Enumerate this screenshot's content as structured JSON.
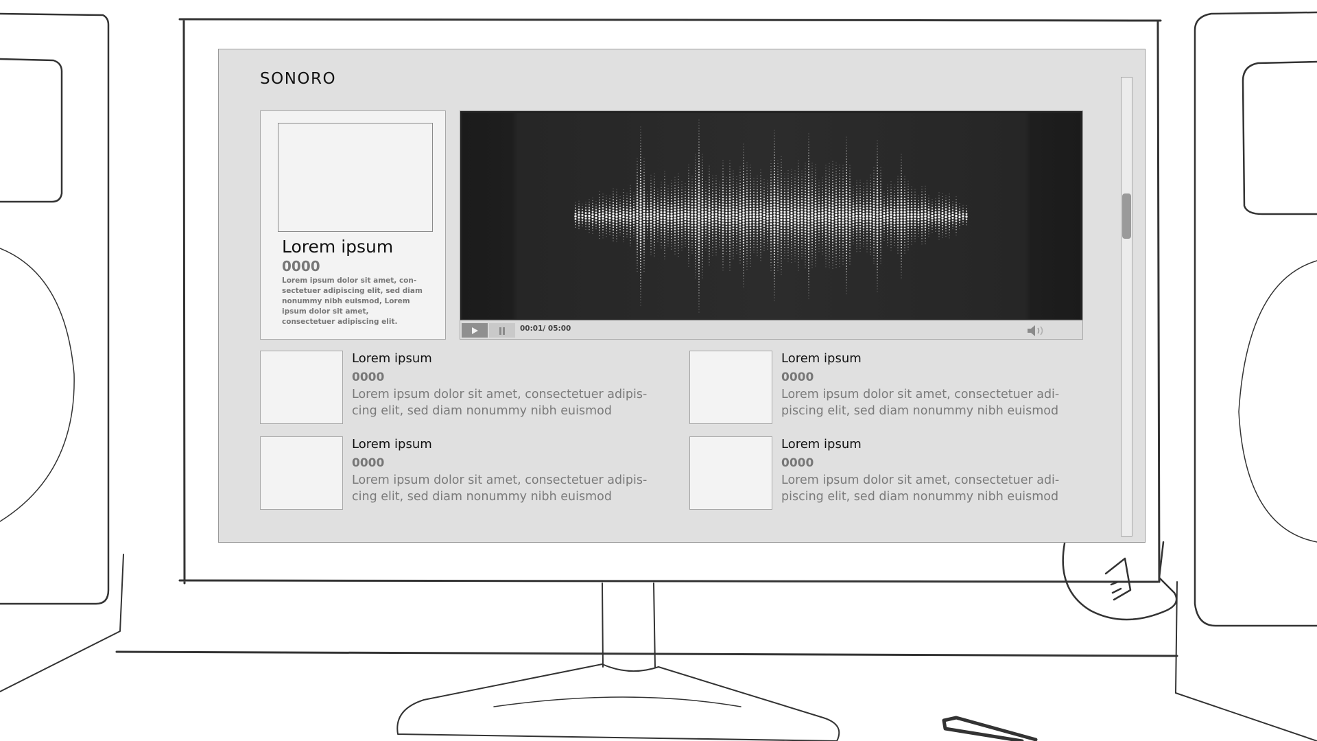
{
  "app": {
    "brand": "SONORO"
  },
  "featured": {
    "title": "Lorem ipsum",
    "number": "0000",
    "description": "Lorem ipsum dolor sit amet, con-sectetuer adipiscing elit, sed diam nonummy nibh euismod, Lorem ipsum dolor sit amet, consectetuer adipiscing elit."
  },
  "player": {
    "time": "00:01/ 05:00",
    "icons": {
      "play": "play-icon",
      "pause": "pause-icon",
      "volume": "volume-icon"
    }
  },
  "items": [
    {
      "title": "Lorem ipsum",
      "number": "0000",
      "description": "Lorem ipsum dolor sit amet, consectetuer adipis-cing elit, sed diam nonummy nibh euismod"
    },
    {
      "title": "Lorem ipsum",
      "number": "0000",
      "description": "Lorem ipsum dolor sit amet, consectetuer adi-piscing elit, sed diam nonummy nibh euismod"
    },
    {
      "title": "Lorem ipsum",
      "number": "0000",
      "description": "Lorem ipsum dolor sit amet, consectetuer adipis-cing elit, sed diam nonummy nibh euismod"
    },
    {
      "title": "Lorem ipsum",
      "number": "0000",
      "description": "Lorem ipsum dolor sit amet, consectetuer adi-piscing elit, sed diam nonummy nibh euismod"
    }
  ],
  "colors": {
    "screen_background": "#e0e0e0",
    "card_background": "#f3f3f3",
    "player_background": "#222222",
    "muted_text": "#777777"
  }
}
